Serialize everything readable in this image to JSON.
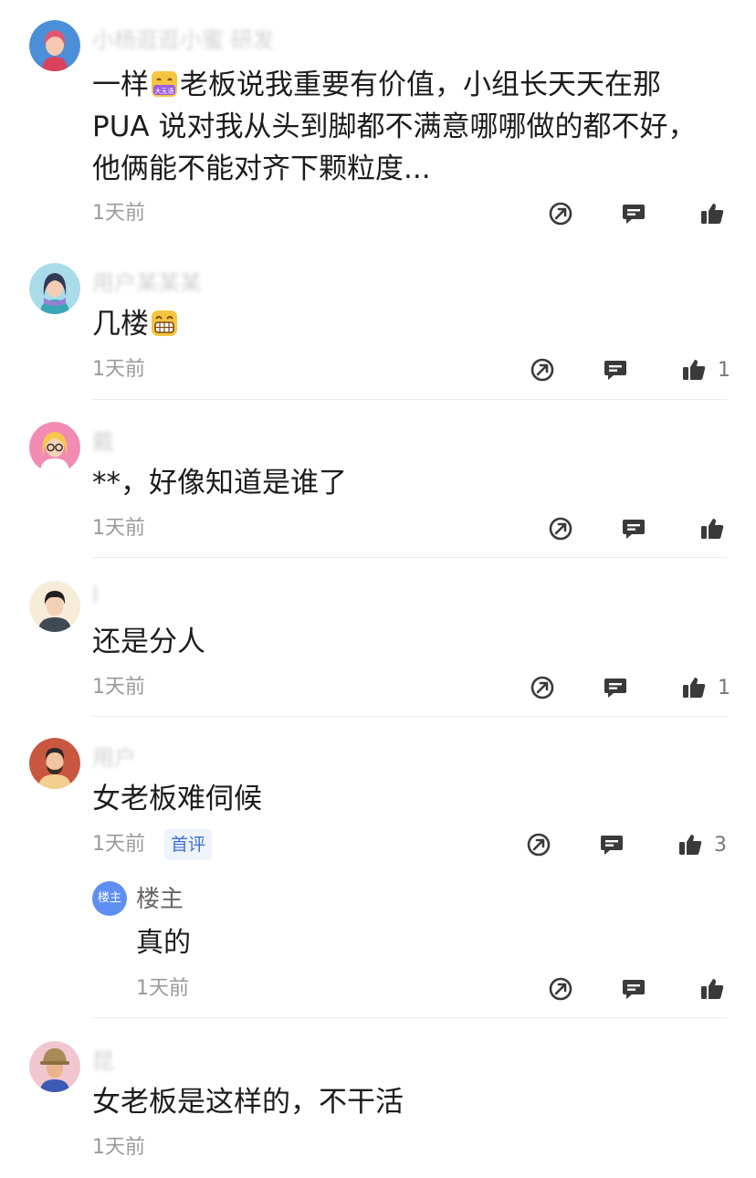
{
  "comments": [
    {
      "author": "小杨逛逛小蜜 研发",
      "avatar": "avatar-woman-red-hair",
      "text_lines": [
        "一样",
        "老板说我重要有价值，小组长天天在那",
        "PUA 说对我从头到脚都不满意哪哪做的都不好，",
        "他俩能不能对齐下颗粒度..."
      ],
      "time": "1天前",
      "likes": ""
    },
    {
      "author": "用户某某某",
      "avatar": "avatar-woman-blue-scarf",
      "text": "几楼",
      "time": "1天前",
      "likes": "1"
    },
    {
      "author": "戴",
      "avatar": "avatar-woman-glasses",
      "text": "**，好像知道是谁了",
      "time": "1天前",
      "likes": ""
    },
    {
      "author": "l",
      "avatar": "avatar-man-dark-hair",
      "text": "还是分人",
      "time": "1天前",
      "likes": "1"
    },
    {
      "author": "用户",
      "avatar": "avatar-man-beard",
      "text": "女老板难伺候",
      "time": "1天前",
      "badge": "首评",
      "likes": "3",
      "reply": {
        "avatar_label": "楼主",
        "author": "楼主",
        "text": "真的",
        "time": "1天前"
      }
    },
    {
      "author": "昆",
      "avatar": "avatar-person-hat",
      "text": "女老板是这样的，不干活",
      "time": "1天前",
      "likes": ""
    }
  ],
  "icons": {
    "share": "share-arrow-icon",
    "reply": "comment-bubble-icon",
    "like": "thumbs-up-icon",
    "emoji_laugh": "grin-emoji",
    "emoji_tag": "大无语"
  },
  "colors": {
    "icon": "#3a3a3a",
    "meta": "#9a9a9a",
    "badge_text": "#3b6fd1",
    "badge_bg": "#eef3fc",
    "reply_avatar": "#5f8ff0"
  }
}
